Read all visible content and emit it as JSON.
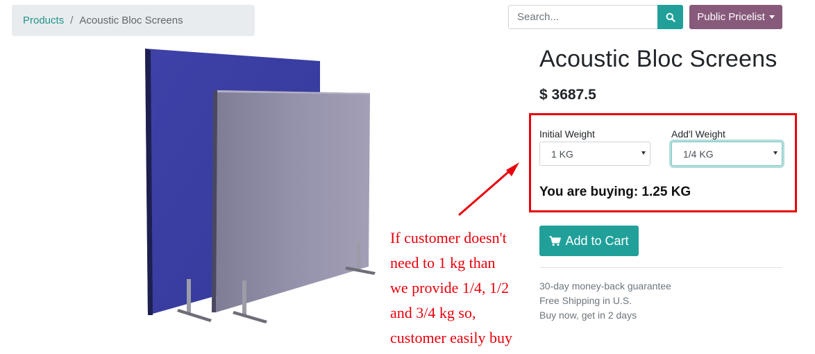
{
  "breadcrumb": {
    "link": "Products",
    "separator": "/",
    "current": "Acoustic Bloc Screens"
  },
  "search": {
    "placeholder": "Search...",
    "icon": "search-icon"
  },
  "pricelist": {
    "label": "Public Pricelist"
  },
  "product": {
    "title": "Acoustic Bloc Screens",
    "price": "$ 3687.5"
  },
  "weights": {
    "initial": {
      "label": "Initial Weight",
      "value": "1 KG"
    },
    "additional": {
      "label": "Add'l Weight",
      "value": "1/4 KG"
    },
    "buying": "You are buying: 1.25 KG"
  },
  "cart": {
    "label": "Add to Cart",
    "icon": "cart-icon"
  },
  "info": [
    "30-day money-back guarantee",
    "Free Shipping in U.S.",
    "Buy now, get in 2 days"
  ],
  "annotation": {
    "lines": [
      "If customer doesn't",
      "need to 1 kg than",
      "we provide 1/4, 1/2",
      "and 3/4 kg so,",
      "customer easily buy"
    ]
  },
  "colors": {
    "teal": "#21a09a",
    "purple": "#875a7b",
    "annotation_red": "#e8000b",
    "blue_panel": "#3d40a3",
    "grey_panel": "#8e8ca4"
  }
}
